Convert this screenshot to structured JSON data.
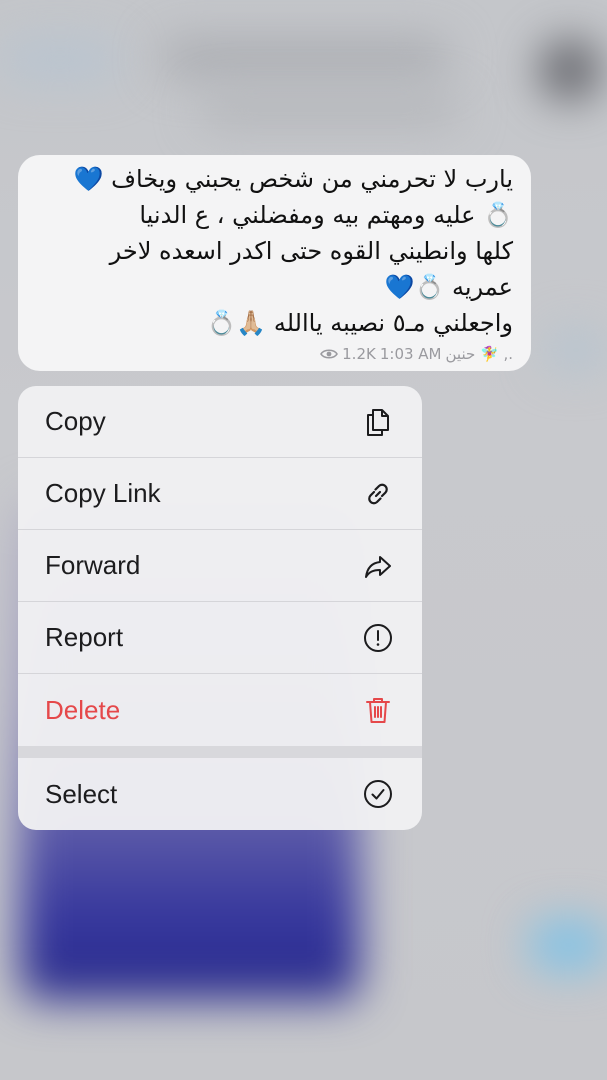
{
  "message": {
    "lines": [
      "يارب لا تحرمني من شخص يحبني ويخاف 💙",
      "💍 عليه ومهتم بيه ومفضلني ، ع الدنيا",
      "كلها وانطيني القوه حتى اكدر اسعده لاخر",
      "ع‍مريه 💍💙",
      "واجعلني مـ٥ نصيبه ياالله 🙏🏼💍"
    ],
    "signature": "حنين 🧚‍♀️ ,.",
    "views": "1.2K",
    "time": "1:03 AM"
  },
  "menu": {
    "items": [
      {
        "label": "Copy",
        "icon": "copy-icon"
      },
      {
        "label": "Copy Link",
        "icon": "link-icon"
      },
      {
        "label": "Forward",
        "icon": "forward-icon"
      },
      {
        "label": "Report",
        "icon": "report-icon"
      },
      {
        "label": "Delete",
        "icon": "trash-icon",
        "color": "#e5484a"
      },
      {
        "label": "Select",
        "icon": "check-circle-icon"
      }
    ]
  }
}
